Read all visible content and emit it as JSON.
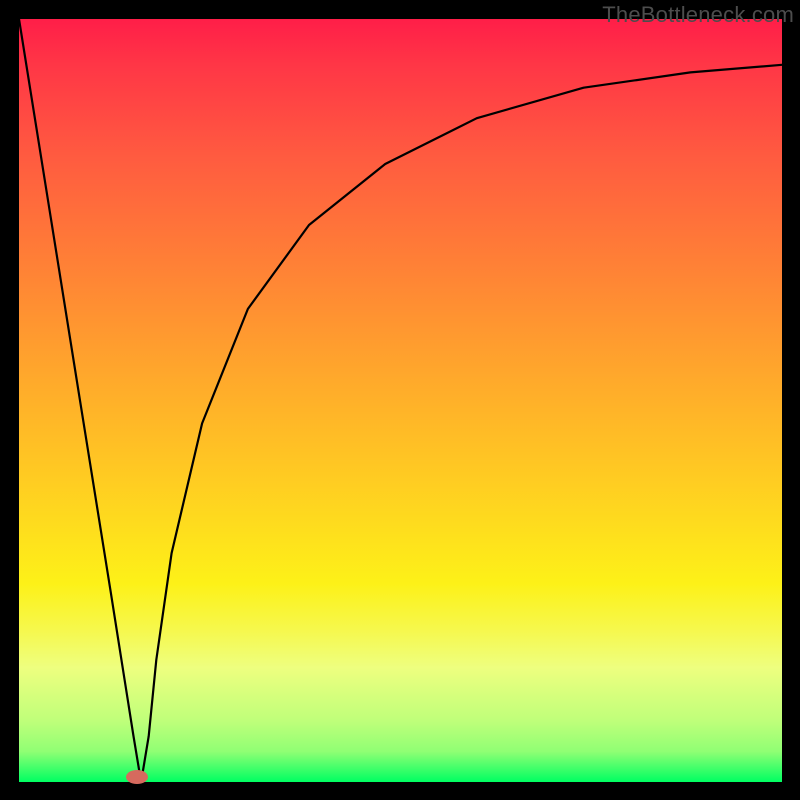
{
  "watermark": "TheBottleneck.com",
  "chart_data": {
    "type": "line",
    "title": "",
    "xlabel": "",
    "ylabel": "",
    "xlim": [
      0,
      100
    ],
    "ylim": [
      0,
      100
    ],
    "grid": false,
    "curve": {
      "description": "V-shaped bottleneck curve: steep near-linear drop from top-left down to a minimum near x≈16, then rises along a decelerating convex arc toward the upper right edge.",
      "x": [
        0,
        4,
        8,
        12,
        15,
        16,
        17,
        18,
        20,
        24,
        30,
        38,
        48,
        60,
        74,
        88,
        100
      ],
      "y": [
        100,
        75,
        50,
        25,
        6,
        0,
        6,
        16,
        30,
        47,
        62,
        73,
        81,
        87,
        91,
        93,
        94
      ],
      "minimum": {
        "x": 16,
        "y": 0
      }
    },
    "marker": {
      "x": 15.5,
      "y": 0.6,
      "color": "#d66a5e"
    },
    "background_gradient": {
      "orientation": "vertical",
      "stops": [
        {
          "pos": 0.0,
          "color": "#ff1e48"
        },
        {
          "pos": 0.32,
          "color": "#ff8036"
        },
        {
          "pos": 0.6,
          "color": "#ffcb22"
        },
        {
          "pos": 0.8,
          "color": "#f6f84c"
        },
        {
          "pos": 1.0,
          "color": "#00ff62"
        }
      ]
    },
    "frame_color": "#000000"
  }
}
